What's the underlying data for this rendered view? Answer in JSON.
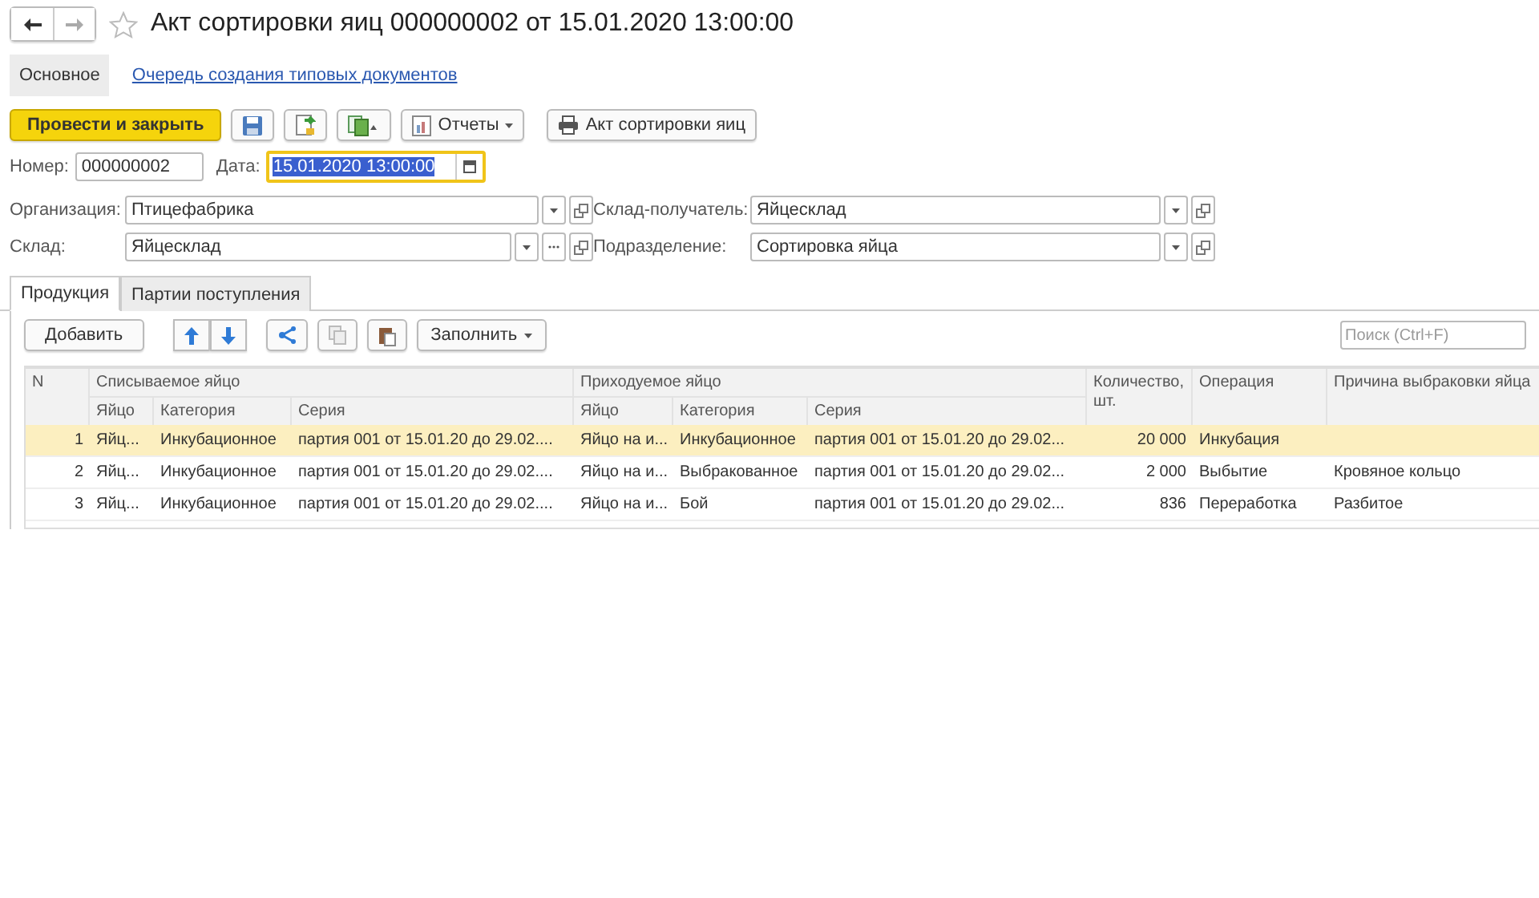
{
  "window": {
    "title": "Акт сортировки яиц 000000002 от 15.01.2020 13:00:00",
    "favorite": false
  },
  "sections": [
    {
      "label": "Основное",
      "selected": true
    },
    {
      "label": "Очередь создания типовых документов",
      "selected": false
    }
  ],
  "toolbar": {
    "primary": "Провести и закрыть",
    "reports": "Отчеты",
    "print": "Акт сортировки яиц"
  },
  "number": {
    "label": "Номер:",
    "value": "000000002"
  },
  "date": {
    "label": "Дата:",
    "value": "15.01.2020 13:00:00"
  },
  "fields": [
    {
      "label": "Организация:",
      "value": "Птицефабрика",
      "ellipsis": false
    },
    {
      "label": "Склад-получатель:",
      "value": "Яйцесклад",
      "ellipsis": false
    },
    {
      "label": "Склад:",
      "value": "Яйцесклад",
      "ellipsis": true
    },
    {
      "label": "Подразделение:",
      "value": "Сортировка яйца",
      "ellipsis": false
    }
  ],
  "tabs": [
    {
      "label": "Продукция",
      "selected": true
    },
    {
      "label": "Партии поступления",
      "selected": false
    }
  ],
  "table_toolbar": {
    "add": "Добавить",
    "fill": "Заполнить",
    "search_placeholder": "Поиск (Ctrl+F)"
  },
  "table": {
    "group_headers": [
      "Списываемое яйцо",
      "Приходуемое яйцо"
    ],
    "columns": [
      "N",
      "Яйцо",
      "Категория",
      "Серия",
      "Яйцо",
      "Категория",
      "Серия",
      "Количество, шт.",
      "Операция",
      "Причина выбраковки яйца"
    ],
    "rows": [
      {
        "selected": true,
        "cells": [
          "1",
          "Яйц...",
          "Инкубационное",
          "партия 001 от 15.01.20 до 29.02....",
          "Яйцо на и...",
          "Инкубационное",
          "партия 001 от 15.01.20 до 29.02...",
          "20 000",
          "Инкубация",
          ""
        ]
      },
      {
        "selected": false,
        "cells": [
          "2",
          "Яйц...",
          "Инкубационное",
          "партия 001 от 15.01.20 до 29.02....",
          "Яйцо на и...",
          "Выбракованное",
          "партия 001 от 15.01.20 до 29.02...",
          "2 000",
          "Выбытие",
          "Кровяное кольцо"
        ]
      },
      {
        "selected": false,
        "cells": [
          "3",
          "Яйц...",
          "Инкубационное",
          "партия 001 от 15.01.20 до 29.02....",
          "Яйцо на и...",
          "Бой",
          "партия 001 от 15.01.20 до 29.02...",
          "836",
          "Переработка",
          "Разбитое"
        ]
      }
    ]
  }
}
